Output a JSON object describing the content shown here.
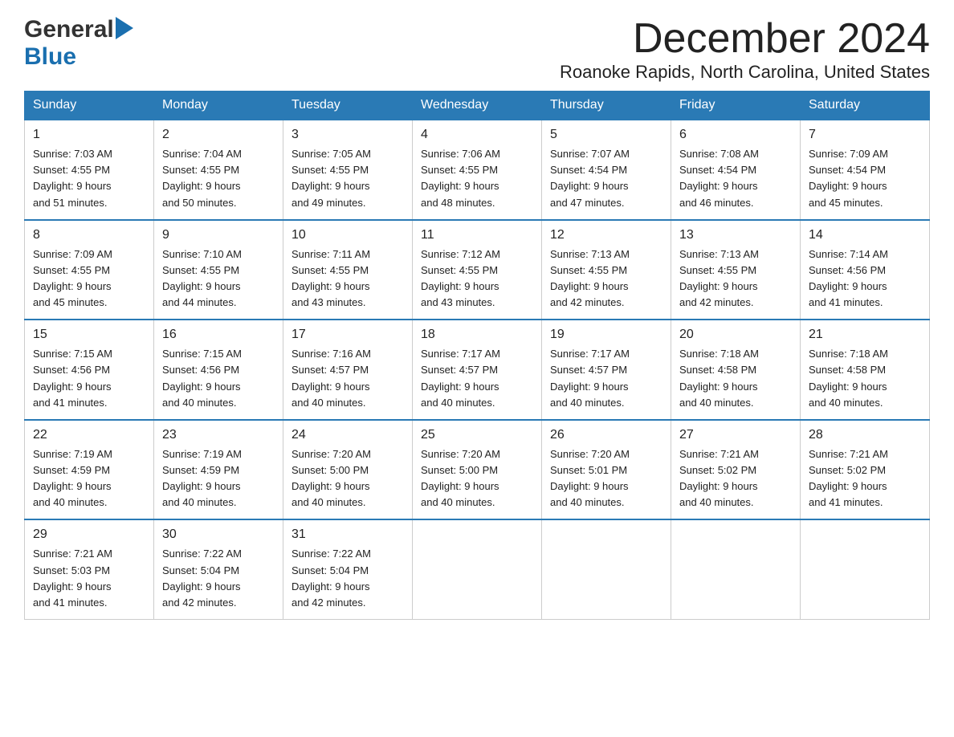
{
  "header": {
    "logo_general": "General",
    "logo_blue": "Blue",
    "month_title": "December 2024",
    "location": "Roanoke Rapids, North Carolina, United States"
  },
  "days_of_week": [
    "Sunday",
    "Monday",
    "Tuesday",
    "Wednesday",
    "Thursday",
    "Friday",
    "Saturday"
  ],
  "weeks": [
    [
      {
        "day": 1,
        "sunrise": "7:03 AM",
        "sunset": "4:55 PM",
        "daylight": "9 hours and 51 minutes."
      },
      {
        "day": 2,
        "sunrise": "7:04 AM",
        "sunset": "4:55 PM",
        "daylight": "9 hours and 50 minutes."
      },
      {
        "day": 3,
        "sunrise": "7:05 AM",
        "sunset": "4:55 PM",
        "daylight": "9 hours and 49 minutes."
      },
      {
        "day": 4,
        "sunrise": "7:06 AM",
        "sunset": "4:55 PM",
        "daylight": "9 hours and 48 minutes."
      },
      {
        "day": 5,
        "sunrise": "7:07 AM",
        "sunset": "4:54 PM",
        "daylight": "9 hours and 47 minutes."
      },
      {
        "day": 6,
        "sunrise": "7:08 AM",
        "sunset": "4:54 PM",
        "daylight": "9 hours and 46 minutes."
      },
      {
        "day": 7,
        "sunrise": "7:09 AM",
        "sunset": "4:54 PM",
        "daylight": "9 hours and 45 minutes."
      }
    ],
    [
      {
        "day": 8,
        "sunrise": "7:09 AM",
        "sunset": "4:55 PM",
        "daylight": "9 hours and 45 minutes."
      },
      {
        "day": 9,
        "sunrise": "7:10 AM",
        "sunset": "4:55 PM",
        "daylight": "9 hours and 44 minutes."
      },
      {
        "day": 10,
        "sunrise": "7:11 AM",
        "sunset": "4:55 PM",
        "daylight": "9 hours and 43 minutes."
      },
      {
        "day": 11,
        "sunrise": "7:12 AM",
        "sunset": "4:55 PM",
        "daylight": "9 hours and 43 minutes."
      },
      {
        "day": 12,
        "sunrise": "7:13 AM",
        "sunset": "4:55 PM",
        "daylight": "9 hours and 42 minutes."
      },
      {
        "day": 13,
        "sunrise": "7:13 AM",
        "sunset": "4:55 PM",
        "daylight": "9 hours and 42 minutes."
      },
      {
        "day": 14,
        "sunrise": "7:14 AM",
        "sunset": "4:56 PM",
        "daylight": "9 hours and 41 minutes."
      }
    ],
    [
      {
        "day": 15,
        "sunrise": "7:15 AM",
        "sunset": "4:56 PM",
        "daylight": "9 hours and 41 minutes."
      },
      {
        "day": 16,
        "sunrise": "7:15 AM",
        "sunset": "4:56 PM",
        "daylight": "9 hours and 40 minutes."
      },
      {
        "day": 17,
        "sunrise": "7:16 AM",
        "sunset": "4:57 PM",
        "daylight": "9 hours and 40 minutes."
      },
      {
        "day": 18,
        "sunrise": "7:17 AM",
        "sunset": "4:57 PM",
        "daylight": "9 hours and 40 minutes."
      },
      {
        "day": 19,
        "sunrise": "7:17 AM",
        "sunset": "4:57 PM",
        "daylight": "9 hours and 40 minutes."
      },
      {
        "day": 20,
        "sunrise": "7:18 AM",
        "sunset": "4:58 PM",
        "daylight": "9 hours and 40 minutes."
      },
      {
        "day": 21,
        "sunrise": "7:18 AM",
        "sunset": "4:58 PM",
        "daylight": "9 hours and 40 minutes."
      }
    ],
    [
      {
        "day": 22,
        "sunrise": "7:19 AM",
        "sunset": "4:59 PM",
        "daylight": "9 hours and 40 minutes."
      },
      {
        "day": 23,
        "sunrise": "7:19 AM",
        "sunset": "4:59 PM",
        "daylight": "9 hours and 40 minutes."
      },
      {
        "day": 24,
        "sunrise": "7:20 AM",
        "sunset": "5:00 PM",
        "daylight": "9 hours and 40 minutes."
      },
      {
        "day": 25,
        "sunrise": "7:20 AM",
        "sunset": "5:00 PM",
        "daylight": "9 hours and 40 minutes."
      },
      {
        "day": 26,
        "sunrise": "7:20 AM",
        "sunset": "5:01 PM",
        "daylight": "9 hours and 40 minutes."
      },
      {
        "day": 27,
        "sunrise": "7:21 AM",
        "sunset": "5:02 PM",
        "daylight": "9 hours and 40 minutes."
      },
      {
        "day": 28,
        "sunrise": "7:21 AM",
        "sunset": "5:02 PM",
        "daylight": "9 hours and 41 minutes."
      }
    ],
    [
      {
        "day": 29,
        "sunrise": "7:21 AM",
        "sunset": "5:03 PM",
        "daylight": "9 hours and 41 minutes."
      },
      {
        "day": 30,
        "sunrise": "7:22 AM",
        "sunset": "5:04 PM",
        "daylight": "9 hours and 42 minutes."
      },
      {
        "day": 31,
        "sunrise": "7:22 AM",
        "sunset": "5:04 PM",
        "daylight": "9 hours and 42 minutes."
      },
      null,
      null,
      null,
      null
    ]
  ],
  "labels": {
    "sunrise": "Sunrise:",
    "sunset": "Sunset:",
    "daylight": "Daylight:"
  }
}
